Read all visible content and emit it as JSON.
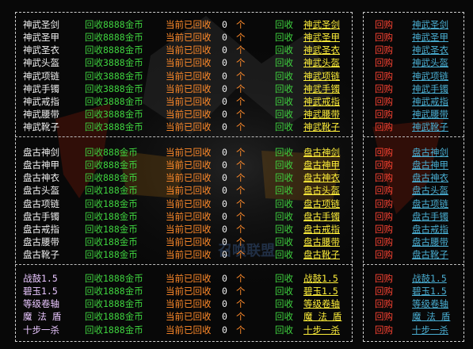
{
  "colors": {
    "background": "#080808",
    "item_white": "#f0f0f0",
    "item_purple": "#e9c6ff",
    "cost_green": "#3fd33f",
    "status_orange": "#ff8a2a",
    "link_yellow": "#ffef3a",
    "return_red": "#ff4433",
    "right_link_blue": "#4aaed2"
  },
  "watermark_text": "召唤联盟",
  "groups": [
    {
      "rows": [
        {
          "name": "神武圣剑",
          "cost": "回收8888金币",
          "status": "当前已回收",
          "count": "0",
          "unit": "个",
          "action": "回收",
          "link": "神武圣剑",
          "ret": "回购",
          "rlink": "神武圣剑"
        },
        {
          "name": "神武圣甲",
          "cost": "回收8888金币",
          "status": "当前已回收",
          "count": "0",
          "unit": "个",
          "action": "回收",
          "link": "神武圣甲",
          "ret": "回购",
          "rlink": "神武圣甲"
        },
        {
          "name": "神武圣衣",
          "cost": "回收8888金币",
          "status": "当前已回收",
          "count": "0",
          "unit": "个",
          "action": "回收",
          "link": "神武圣衣",
          "ret": "回购",
          "rlink": "神武圣衣"
        },
        {
          "name": "神武头盔",
          "cost": "回收3888金币",
          "status": "当前已回收",
          "count": "0",
          "unit": "个",
          "action": "回收",
          "link": "神武头盔",
          "ret": "回购",
          "rlink": "神武头盔"
        },
        {
          "name": "神武项链",
          "cost": "回收3888金币",
          "status": "当前已回收",
          "count": "0",
          "unit": "个",
          "action": "回收",
          "link": "神武项链",
          "ret": "回购",
          "rlink": "神武项链"
        },
        {
          "name": "神武手镯",
          "cost": "回收3888金币",
          "status": "当前已回收",
          "count": "0",
          "unit": "个",
          "action": "回收",
          "link": "神武手镯",
          "ret": "回购",
          "rlink": "神武手镯"
        },
        {
          "name": "神武戒指",
          "cost": "回收3888金币",
          "status": "当前已回收",
          "count": "0",
          "unit": "个",
          "action": "回收",
          "link": "神武戒指",
          "ret": "回购",
          "rlink": "神武戒指"
        },
        {
          "name": "神武腰带",
          "cost": "回收3888金币",
          "status": "当前已回收",
          "count": "0",
          "unit": "个",
          "action": "回收",
          "link": "神武腰带",
          "ret": "回购",
          "rlink": "神武腰带"
        },
        {
          "name": "神武靴子",
          "cost": "回收3888金币",
          "status": "当前已回收",
          "count": "0",
          "unit": "个",
          "action": "回收",
          "link": "神武靴子",
          "ret": "回购",
          "rlink": "神武靴子"
        }
      ]
    },
    {
      "rows": [
        {
          "name": "盘古神剑",
          "cost": "回收888金币",
          "status": "当前已回收",
          "count": "0",
          "unit": "个",
          "action": "回收",
          "link": "盘古神剑",
          "ret": "回购",
          "rlink": "盘古神剑"
        },
        {
          "name": "盘古神甲",
          "cost": "回收888金币",
          "status": "当前已回收",
          "count": "0",
          "unit": "个",
          "action": "回收",
          "link": "盘古神甲",
          "ret": "回购",
          "rlink": "盘古神甲"
        },
        {
          "name": "盘古神衣",
          "cost": "回收888金币",
          "status": "当前已回收",
          "count": "0",
          "unit": "个",
          "action": "回收",
          "link": "盘古神衣",
          "ret": "回购",
          "rlink": "盘古神衣"
        },
        {
          "name": "盘古头盔",
          "cost": "回收188金币",
          "status": "当前已回收",
          "count": "0",
          "unit": "个",
          "action": "回收",
          "link": "盘古头盔",
          "ret": "回购",
          "rlink": "盘古头盔"
        },
        {
          "name": "盘古项链",
          "cost": "回收188金币",
          "status": "当前已回收",
          "count": "0",
          "unit": "个",
          "action": "回收",
          "link": "盘古项链",
          "ret": "回购",
          "rlink": "盘古项链"
        },
        {
          "name": "盘古手镯",
          "cost": "回收188金币",
          "status": "当前已回收",
          "count": "0",
          "unit": "个",
          "action": "回收",
          "link": "盘古手镯",
          "ret": "回购",
          "rlink": "盘古手镯"
        },
        {
          "name": "盘古戒指",
          "cost": "回收188金币",
          "status": "当前已回收",
          "count": "0",
          "unit": "个",
          "action": "回收",
          "link": "盘古戒指",
          "ret": "回购",
          "rlink": "盘古戒指"
        },
        {
          "name": "盘古腰带",
          "cost": "回收188金币",
          "status": "当前已回收",
          "count": "0",
          "unit": "个",
          "action": "回收",
          "link": "盘古腰带",
          "ret": "回购",
          "rlink": "盘古腰带"
        },
        {
          "name": "盘古靴子",
          "cost": "回收188金币",
          "status": "当前已回收",
          "count": "0",
          "unit": "个",
          "action": "回收",
          "link": "盘古靴子",
          "ret": "回购",
          "rlink": "盘古靴子"
        }
      ]
    },
    {
      "rows": [
        {
          "name": "战鼓1.5",
          "cost": "回收1888金币",
          "status": "当前已回收",
          "count": "0",
          "unit": "个",
          "action": "回收",
          "link": "战鼓1.5",
          "ret": "回购",
          "rlink": "战鼓1.5"
        },
        {
          "name": "碧玉1.5",
          "cost": "回收1888金币",
          "status": "当前已回收",
          "count": "0",
          "unit": "个",
          "action": "回收",
          "link": "碧玉1.5",
          "ret": "回购",
          "rlink": "碧玉1.5"
        },
        {
          "name": "等级卷轴",
          "cost": "回收1888金币",
          "status": "当前已回收",
          "count": "0",
          "unit": "个",
          "action": "回收",
          "link": "等级卷轴",
          "ret": "回购",
          "rlink": "等级卷轴"
        },
        {
          "name": "魔 法 盾",
          "cost": "回收1888金币",
          "status": "当前已回收",
          "count": "0",
          "unit": "个",
          "action": "回收",
          "link": "魔 法 盾",
          "ret": "回购",
          "rlink": "魔 法 盾"
        },
        {
          "name": "十步一杀",
          "cost": "回收1888金币",
          "status": "当前已回收",
          "count": "0",
          "unit": "个",
          "action": "回收",
          "link": "十步一杀",
          "ret": "回购",
          "rlink": "十步一杀"
        }
      ]
    }
  ]
}
